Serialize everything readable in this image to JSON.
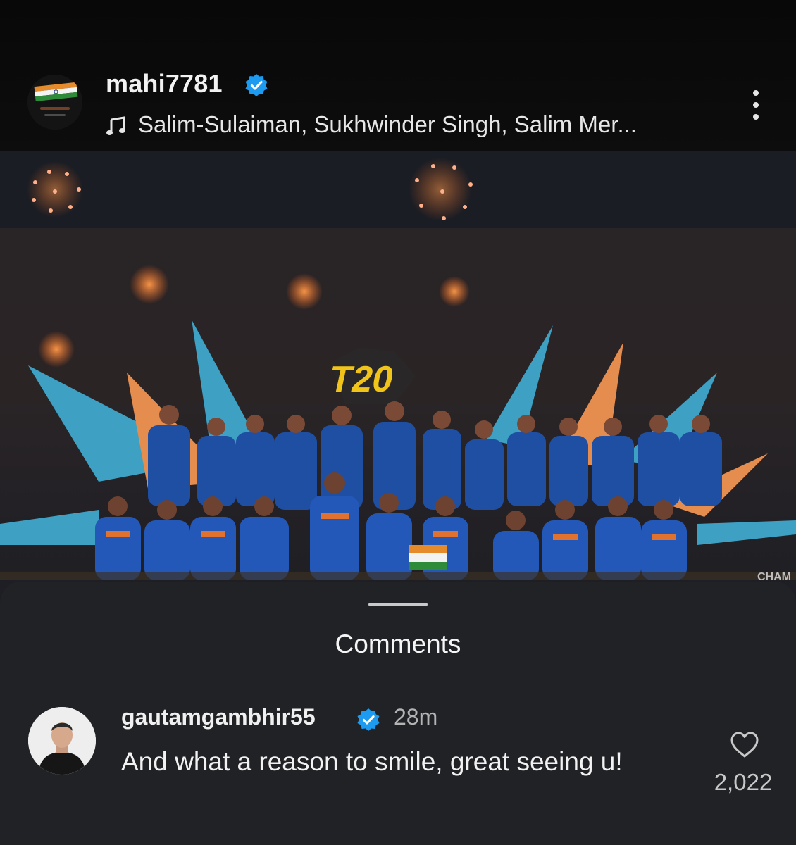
{
  "post": {
    "username": "mahi7781",
    "music": "Salim-Sulaiman, Sukhwinder Singh, Salim Mer...",
    "avatar_icon": "india-flag-avatar-icon",
    "more_icon": "more-vertical-icon",
    "photo": {
      "description_icon": "team-celebration-photo",
      "trophy_logo_text": "T20",
      "banner_text": "CHAM"
    }
  },
  "comments": {
    "title": "Comments",
    "items": [
      {
        "username": "gautamgambhir55",
        "time": "28m",
        "text": "And what a reason to smile, great seeing u!",
        "likes": "2,022",
        "like_icon": "heart-outline-icon"
      }
    ]
  },
  "colors": {
    "verified": "#1d9bf0",
    "sheet_bg": "#212226",
    "header_bg": "#0b0b0b"
  }
}
